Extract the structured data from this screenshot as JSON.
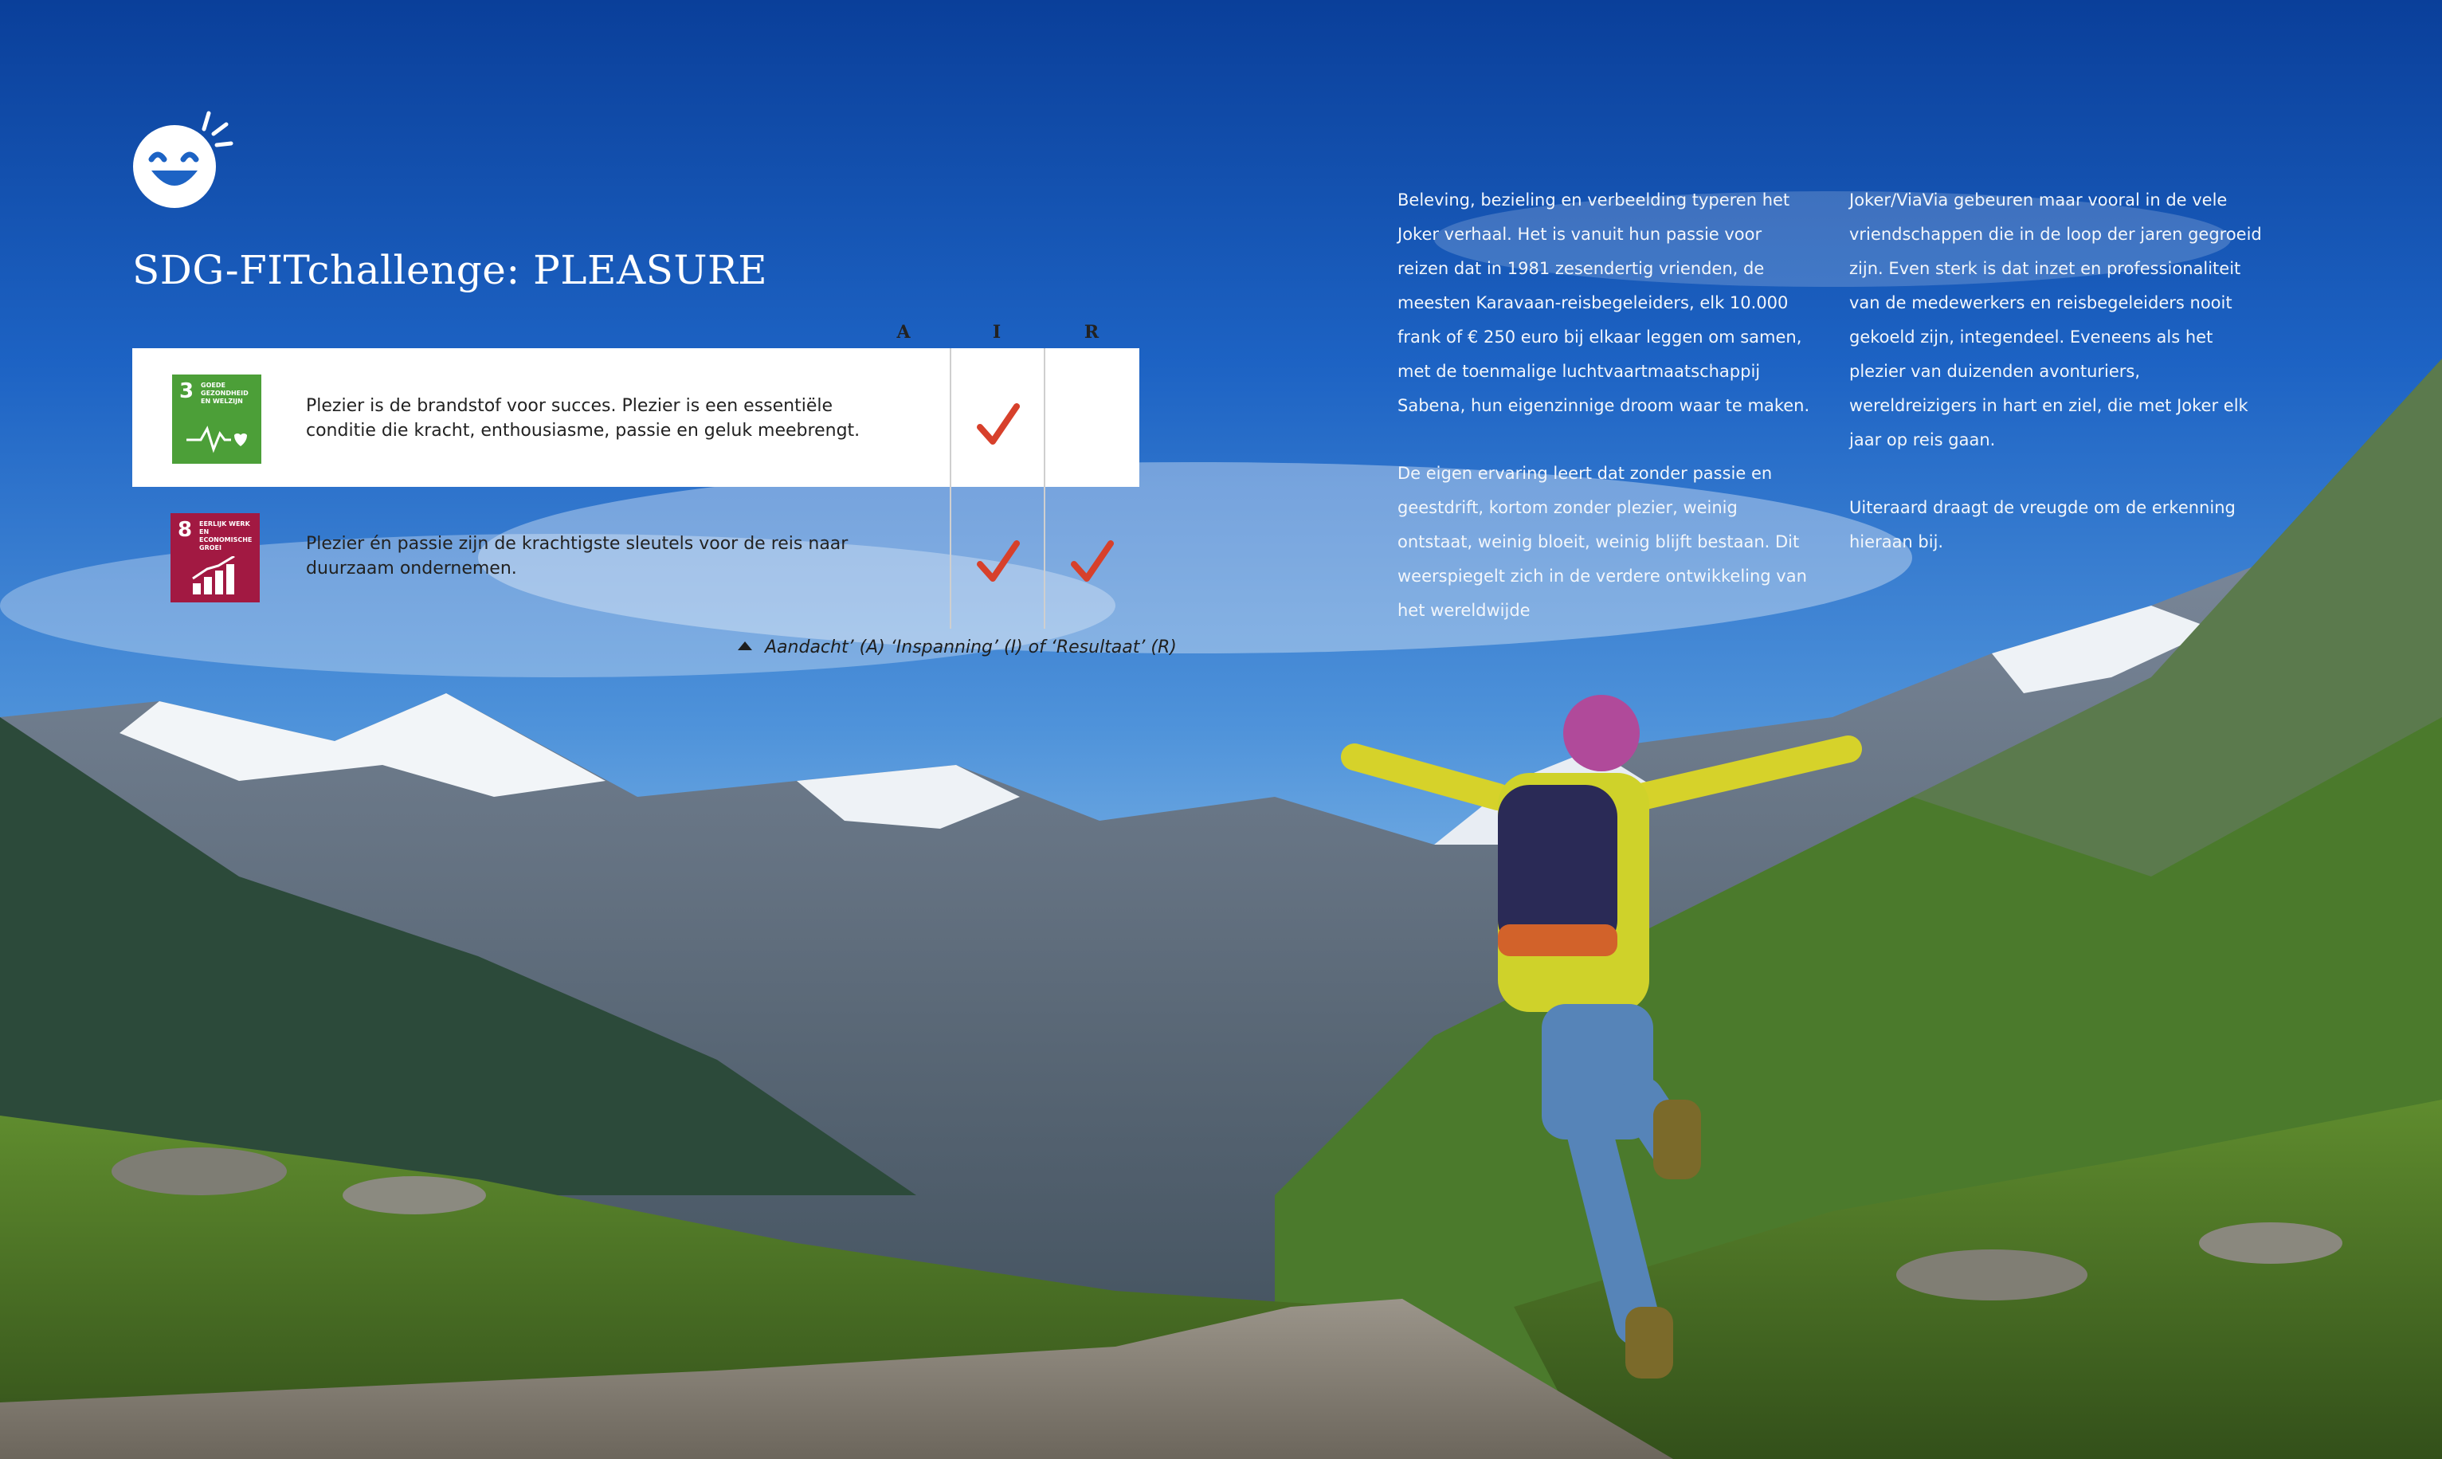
{
  "page": {
    "title": "SDG-FITchallenge: PLEASURE",
    "icon": "laughing-smiley-icon"
  },
  "table": {
    "columns": [
      "A",
      "I",
      "R"
    ],
    "rows": [
      {
        "sdg_number": "3",
        "sdg_label": "Goede gezondheid en welzijn",
        "sdg_color": "#4c9f38",
        "text": "Plezier is de brandstof voor succes. Plezier is een essentiële conditie die kracht, enthousiasme, passie en geluk meebrengt.",
        "checks": [
          false,
          true,
          false
        ]
      },
      {
        "sdg_number": "8",
        "sdg_label": "Eerlijk werk en economische groei",
        "sdg_color": "#a21942",
        "text": "Plezier én passie zijn de krachtigste sleutels voor de reis naar duurzaam ondernemen.",
        "checks": [
          false,
          true,
          true
        ]
      }
    ],
    "caption": "Aandacht’ (A) ‘Inspanning’ (I) of ‘Resultaat’ (R)",
    "check_color": "#d7402b"
  },
  "body": {
    "col1": [
      "Beleving, bezieling en verbeelding typeren het Joker verhaal. Het is vanuit hun passie voor reizen dat in 1981 zesendertig vrienden, de meesten Karavaan-reisbegeleiders, elk 10.000 frank of € 250 euro bij elkaar leggen om samen, met de toenmalige luchtvaartmaatschappij Sabena, hun eigenzinnige droom waar te maken.",
      "De eigen ervaring leert dat zonder passie en geestdrift, kortom zonder plezier, weinig ontstaat, weinig bloeit, weinig blijft bestaan. Dit weerspiegelt zich in de verdere ontwikkeling van het wereldwijde"
    ],
    "col2": [
      "Joker/ViaVia gebeuren maar vooral in de vele vriendschappen die in de loop der jaren gegroeid zijn.  Even sterk is dat inzet en professionaliteit van de medewerkers en reisbegeleiders nooit gekoeld zijn, integendeel. Eveneens als het plezier van duizenden avonturiers, wereldreizigers in hart en ziel, die met Joker elk jaar op reis gaan.",
      "Uiteraard draagt de vreugde om de erkenning hieraan bij."
    ]
  }
}
